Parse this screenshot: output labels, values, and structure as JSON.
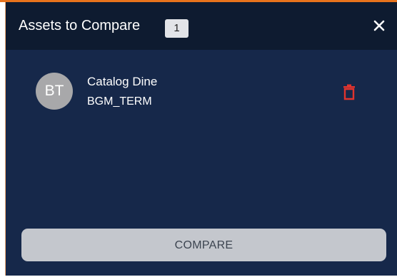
{
  "header": {
    "title": "Assets to Compare",
    "count": "1"
  },
  "icons": {
    "close": "close-icon",
    "delete": "trash-icon"
  },
  "assets": [
    {
      "initials": "BT",
      "name": "Catalog Dine",
      "code": "BGM_TERM"
    }
  ],
  "footer": {
    "compare_label": "COMPARE"
  },
  "colors": {
    "header_bg": "#0e1b30",
    "panel_bg": "#16284a",
    "accent": "#e8731c",
    "delete": "#e0342e",
    "button_bg": "#c4c7cd"
  }
}
